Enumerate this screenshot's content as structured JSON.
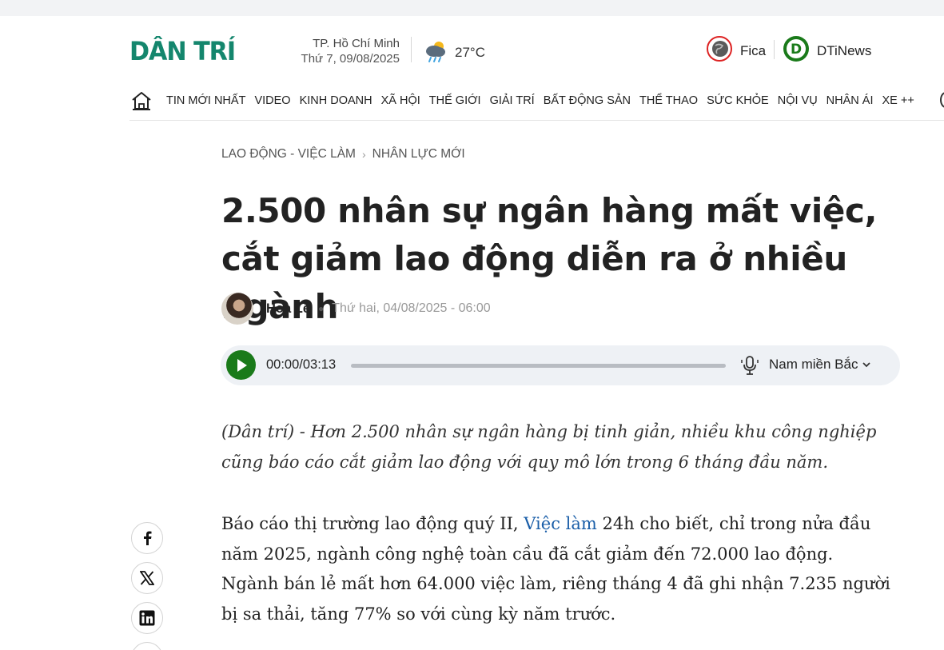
{
  "header": {
    "logo_text": "DÂN TRÍ",
    "location": "TP. Hồ Chí Minh",
    "date": "Thứ 7, 09/08/2025",
    "temperature": "27°C",
    "weather_icon": "cloud-sun-rain-icon",
    "partners": [
      {
        "label": "Fica",
        "icon": "fica-globe-icon"
      },
      {
        "label": "DTiNews",
        "icon": "dtinews-d-icon"
      }
    ]
  },
  "nav": {
    "home_icon": "home-icon",
    "items": [
      "TIN MỚI NHẤT",
      "VIDEO",
      "KINH DOANH",
      "XÃ HỘI",
      "THẾ GIỚI",
      "GIẢI TRÍ",
      "BẤT ĐỘNG SẢN",
      "THỂ THAO",
      "SỨC KHỎE",
      "NỘI VỤ",
      "NHÂN ÁI",
      "XE ++"
    ]
  },
  "breadcrumb": {
    "parent": "LAO ĐỘNG - VIỆC LÀM",
    "current": "NHÂN LỰC MỚI"
  },
  "article": {
    "title": "2.500 nhân sự ngân hàng mất việc, cắt giảm lao động diễn ra ở nhiều ngành",
    "author": "Hoa Lê",
    "published": "Thứ hai, 04/08/2025 - 06:00",
    "sapo": "(Dân trí) - Hơn 2.500 nhân sự ngân hàng bị tinh giản, nhiều khu công nghiệp cũng báo cáo cắt giảm lao động với quy mô lớn trong 6 tháng đầu năm.",
    "para1_before": "Báo cáo thị trường lao động quý II, ",
    "para1_link": "Việc làm",
    "para1_after": " 24h cho biết, chỉ trong nửa đầu năm 2025, ngành công nghệ toàn cầu đã cắt giảm đến 72.000 lao động. Ngành bán lẻ mất hơn 64.000 việc làm, riêng tháng 4 đã ghi nhận 7.235 người bị sa thải, tăng 77% so với cùng kỳ năm trước."
  },
  "audio": {
    "time": "00:00/03:13",
    "voice": "Nam miền Bắc",
    "progress": 0
  },
  "share": [
    "facebook-icon",
    "x-icon",
    "linkedin-icon"
  ],
  "colors": {
    "brand": "#14866d",
    "play": "#1a7a1a",
    "link": "#1a5ea8"
  }
}
